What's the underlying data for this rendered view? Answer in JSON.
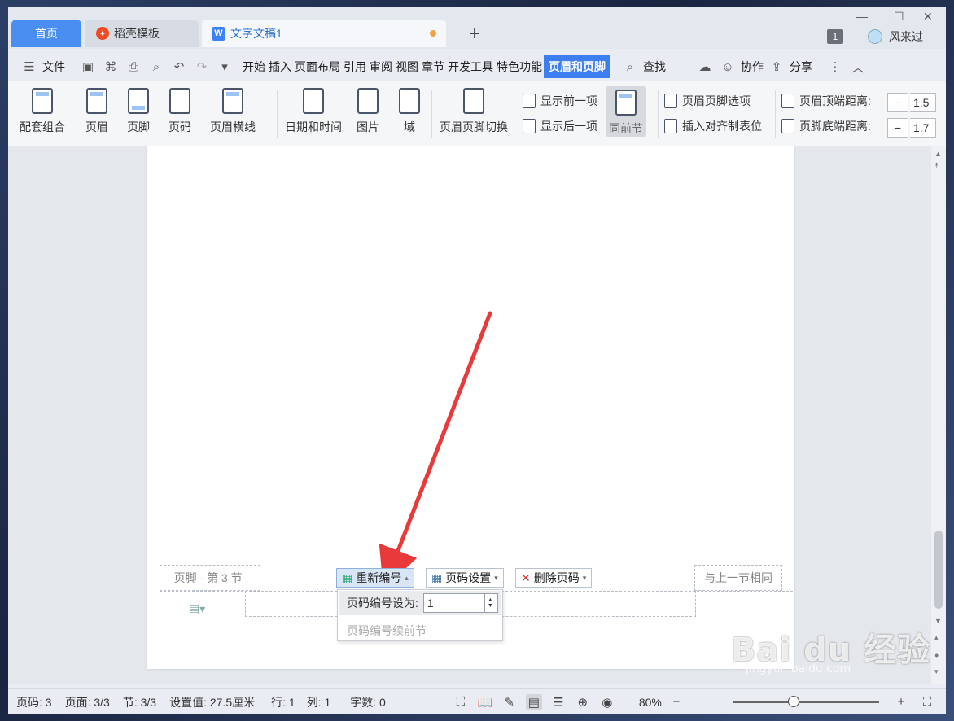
{
  "tabs": {
    "home": "首页",
    "daoke": "稻壳模板",
    "doc": "文字文稿1",
    "add": "+"
  },
  "titlebar": {
    "badge": "1",
    "user": "风来过"
  },
  "menu": {
    "file": "文件",
    "items": [
      "开始",
      "插入",
      "页面布局",
      "引用",
      "审阅",
      "视图",
      "章节",
      "开发工具",
      "特色功能"
    ],
    "active": "页眉和页脚",
    "search": "查找",
    "collab": "协作",
    "share": "分享"
  },
  "ribbon": {
    "combo": "配套组合",
    "header": "页眉",
    "footer": "页脚",
    "pagenum": "页码",
    "hline": "页眉横线",
    "datetime": "日期和时间",
    "picture": "图片",
    "field": "域",
    "switch": "页眉页脚切换",
    "prev": "显示前一项",
    "next": "显示后一项",
    "sameprev": "同前节",
    "options": "页眉页脚选项",
    "align_tab": "插入对齐制表位",
    "top_dist_label": "页眉顶端距离:",
    "top_dist_val": "1.5",
    "bot_dist_label": "页脚底端距离:",
    "bot_dist_val": "1.7",
    "minus": "−"
  },
  "footer_area": {
    "tag": "页脚 - 第 3 节-",
    "same": "与上一节相同",
    "renumber": "重新编号",
    "pageset": "页码设置",
    "delete": "删除页码",
    "dropdown_label": "页码编号设为:",
    "dropdown_value": "1",
    "dropdown_continue": "页码编号续前节"
  },
  "status": {
    "pagenum": "页码: 3",
    "pages": "页面: 3/3",
    "section": "节: 3/3",
    "setting": "设置值: 27.5厘米",
    "row": "行: 1",
    "col": "列: 1",
    "words": "字数: 0",
    "zoom": "80%"
  },
  "watermark": {
    "logo": "Bai du 经验",
    "url": "jingyan.baidu.com"
  }
}
